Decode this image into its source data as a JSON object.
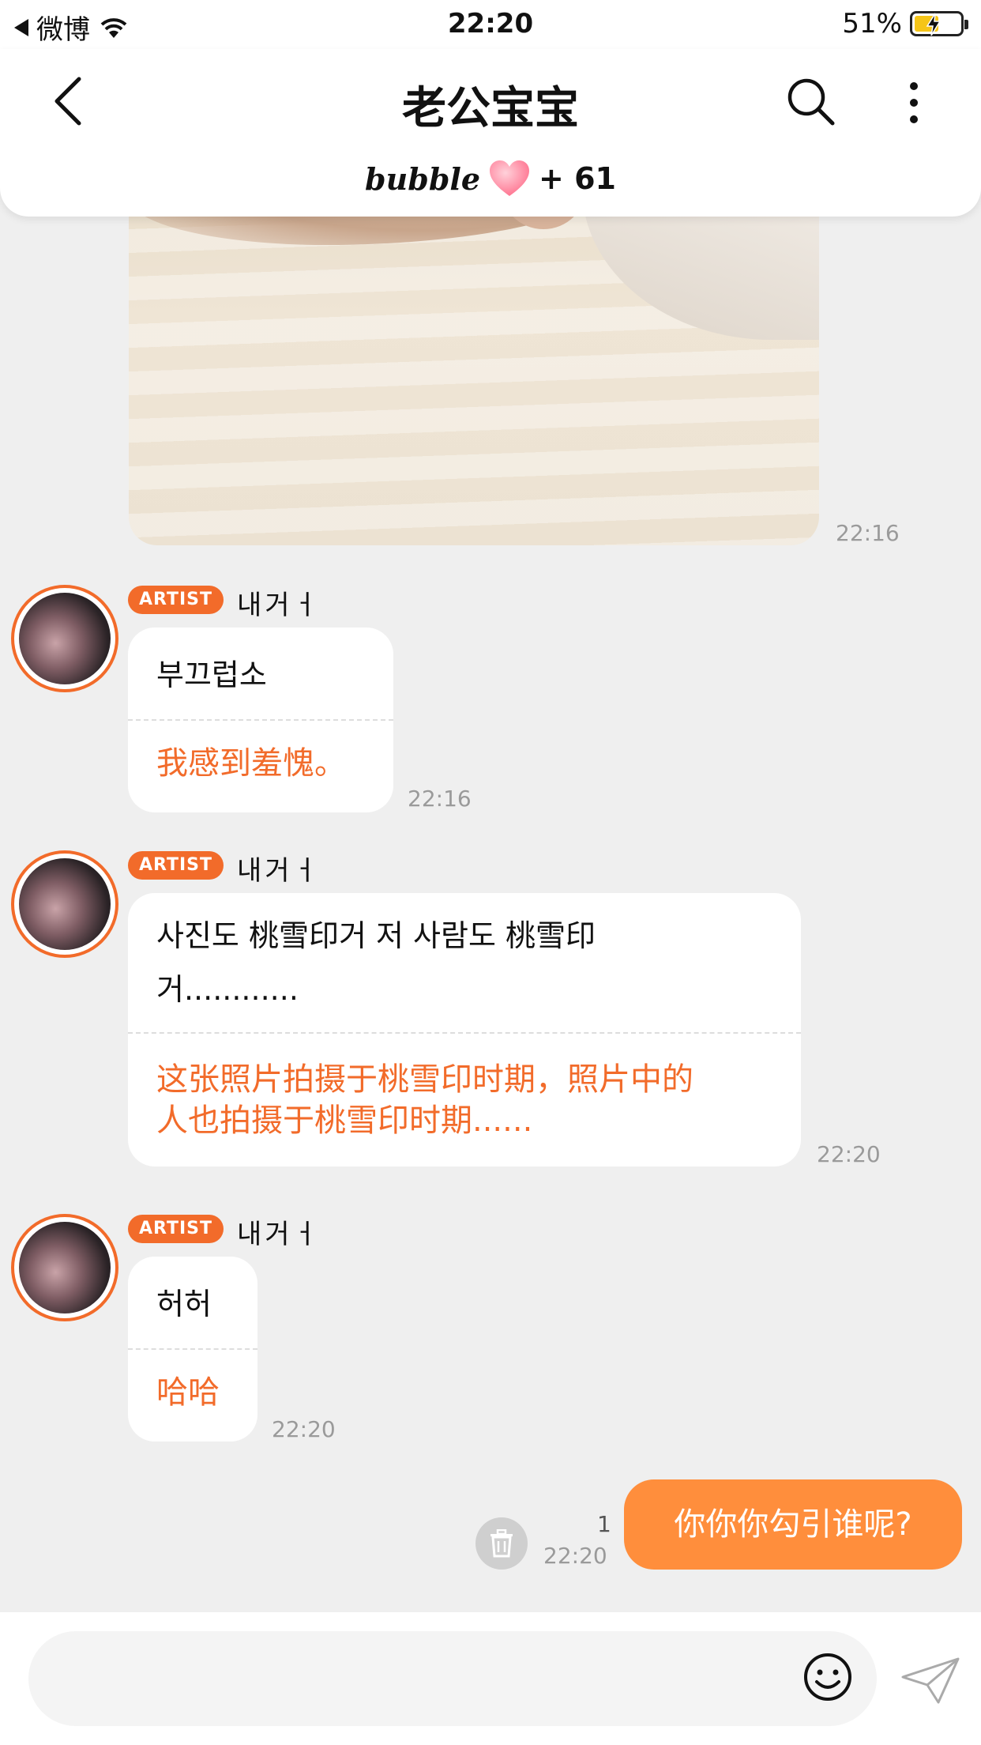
{
  "status_bar": {
    "back_app": "微博",
    "time": "22:20",
    "battery": "51%"
  },
  "header": {
    "title": "老公宝宝",
    "bubble_label": "bubble",
    "bubble_count": "+ 61"
  },
  "photo_message": {
    "time": "22:16"
  },
  "messages": [
    {
      "badge": "ARTIST",
      "sender": "내거ㅓ",
      "original": "부끄럽소",
      "translation": "我感到羞愧。",
      "time": "22:16"
    },
    {
      "badge": "ARTIST",
      "sender": "내거ㅓ",
      "original_line1": "사진도 桃雪印거 저 사람도 桃雪印",
      "original_line2": "거............",
      "translation_line1": "这张照片拍摄于桃雪印时期，照片中的",
      "translation_line2": "人也拍摄于桃雪印时期......",
      "time": "22:20"
    },
    {
      "badge": "ARTIST",
      "sender": "내거ㅓ",
      "original": "허허",
      "translation": "哈哈",
      "time": "22:20"
    }
  ],
  "outgoing": {
    "text": "你你你勾引谁呢?",
    "unread_count": "1",
    "time": "22:20"
  },
  "input": {
    "placeholder": ""
  },
  "colors": {
    "accent": "#f26b2a",
    "outgoing_bubble": "#ff8e3c",
    "background": "#efefef"
  }
}
